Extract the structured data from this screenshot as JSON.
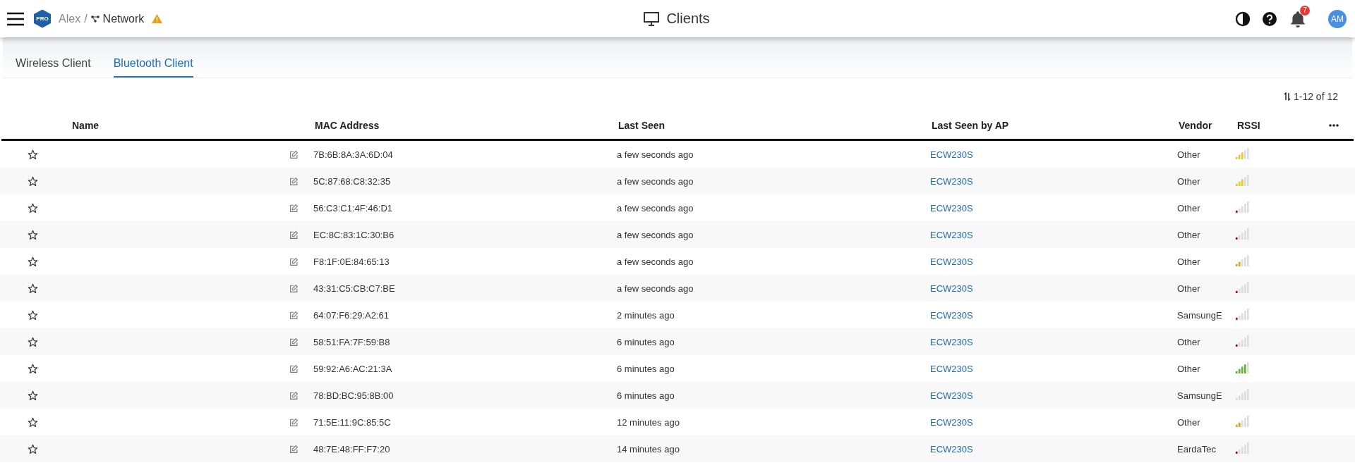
{
  "header": {
    "logo": "PRO",
    "breadcrumb": {
      "site": "Alex",
      "separator": "/",
      "network": "Network",
      "warning": true
    },
    "title": "Clients",
    "notifications": "7",
    "avatar": "AM"
  },
  "tabs": [
    {
      "label": "Wireless Client",
      "selected": false
    },
    {
      "label": "Bluetooth Client",
      "selected": true
    }
  ],
  "pagination": "1-12 of 12",
  "table": {
    "columns": [
      "Name",
      "MAC Address",
      "Last Seen",
      "Last Seen by AP",
      "Vendor",
      "RSSI"
    ],
    "rows": [
      {
        "mac": "7B:6B:8A:3A:6D:04",
        "last_seen": "a few seconds ago",
        "ap": "ECW230S",
        "vendor": "Other",
        "kind": "fair"
      },
      {
        "mac": "5C:87:68:C8:32:35",
        "last_seen": "a few seconds ago",
        "ap": "ECW230S",
        "vendor": "Other",
        "kind": "fair"
      },
      {
        "mac": "56:C3:C1:4F:46:D1",
        "last_seen": "a few seconds ago",
        "ap": "ECW230S",
        "vendor": "Other",
        "kind": "weak"
      },
      {
        "mac": "EC:8C:83:1C:30:B6",
        "last_seen": "a few seconds ago",
        "ap": "ECW230S",
        "vendor": "Other",
        "kind": "weak"
      },
      {
        "mac": "F8:1F:0E:84:65:13",
        "last_seen": "a few seconds ago",
        "ap": "ECW230S",
        "vendor": "Other",
        "kind": "low"
      },
      {
        "mac": "43:31:C5:CB:C7:BE",
        "last_seen": "a few seconds ago",
        "ap": "ECW230S",
        "vendor": "Other",
        "kind": "weak"
      },
      {
        "mac": "64:07:F6:29:A2:61",
        "last_seen": "2 minutes ago",
        "ap": "ECW230S",
        "vendor": "SamsungE",
        "kind": "weak"
      },
      {
        "mac": "58:51:FA:7F:59:B8",
        "last_seen": "6 minutes ago",
        "ap": "ECW230S",
        "vendor": "Other",
        "kind": "weak"
      },
      {
        "mac": "59:92:A6:AC:21:3A",
        "last_seen": "6 minutes ago",
        "ap": "ECW230S",
        "vendor": "Other",
        "kind": "good"
      },
      {
        "mac": "78:BD:BC:95:8B:00",
        "last_seen": "6 minutes ago",
        "ap": "ECW230S",
        "vendor": "SamsungE",
        "kind": "none"
      },
      {
        "mac": "71:5E:11:9C:85:5C",
        "last_seen": "12 minutes ago",
        "ap": "ECW230S",
        "vendor": "Other",
        "kind": "low"
      },
      {
        "mac": "48:7E:48:FF:F7:20",
        "last_seen": "14 minutes ago",
        "ap": "ECW230S",
        "vendor": "EardaTec",
        "kind": "weak"
      }
    ]
  }
}
